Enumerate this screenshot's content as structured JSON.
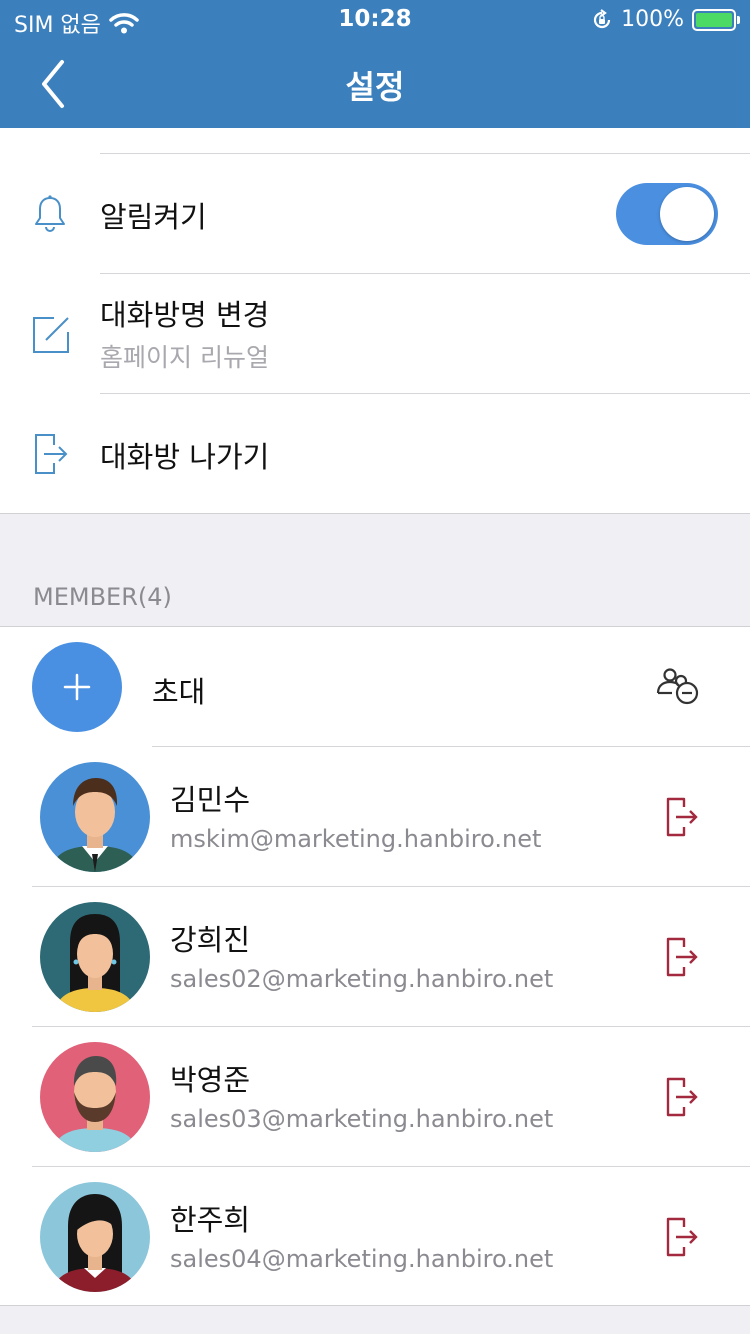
{
  "status_bar": {
    "carrier": "SIM 없음",
    "time": "10:28",
    "battery": "100%",
    "icons": [
      "wifi-icon",
      "rotation-lock-icon",
      "battery-charging-icon"
    ]
  },
  "nav": {
    "title": "설정",
    "back_icon": "chevron-left-icon",
    "background": "#3b80bd"
  },
  "settings": {
    "notifications": {
      "label": "알림켜기",
      "icon": "bell-icon",
      "enabled": true,
      "toggle_color": "#4a8fe0"
    },
    "rename": {
      "label": "대화방명 변경",
      "value": "홈페이지 리뉴얼",
      "icon": "edit-icon"
    },
    "leave": {
      "label": "대화방 나가기",
      "icon": "exit-icon"
    }
  },
  "members_section": {
    "header": "MEMBER(4)",
    "invite_label": "초대",
    "invite_color": "#4a90e2",
    "kick_color": "#a3293f",
    "members": [
      {
        "name": "김민수",
        "email": "mskim@marketing.hanbiro.net"
      },
      {
        "name": "강희진",
        "email": "sales02@marketing.hanbiro.net"
      },
      {
        "name": "박영준",
        "email": "sales03@marketing.hanbiro.net"
      },
      {
        "name": "한주희",
        "email": "sales04@marketing.hanbiro.net"
      }
    ]
  }
}
